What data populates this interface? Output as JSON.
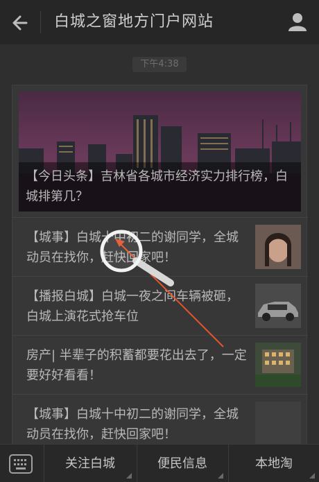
{
  "header": {
    "title": "白城之窗地方门户网站",
    "back_icon": "back-arrow-icon",
    "profile_icon": "user-icon"
  },
  "chat": {
    "timestamp": "下午4:38",
    "hero": {
      "caption": "【今日头条】吉林省各城市经济实力排行榜，白城排第几？"
    },
    "items": [
      {
        "text": "【城事】白城十中初二的谢同学，全城动员在找你，赶快回家吧！",
        "thumb": "portrait-photo"
      },
      {
        "text": "【播报白城】白城一夜之间车辆被砸，白城上演花式抢车位",
        "thumb": "car-photo"
      },
      {
        "text": "房产| 半辈子的积蓄都要花出去了，一定要好好看看！",
        "thumb": "building-photo"
      },
      {
        "text": "【城事】白城十中初二的谢同学，全城动员在找你，赶快回家吧！",
        "thumb": "blank"
      }
    ]
  },
  "bottom_menu": {
    "keyboard_icon": "keyboard-icon",
    "items": [
      "关注白城",
      "便民信息",
      "本地淘"
    ]
  },
  "colors": {
    "header_bg": "#262626",
    "annotation_arrow": "#e8542a"
  }
}
